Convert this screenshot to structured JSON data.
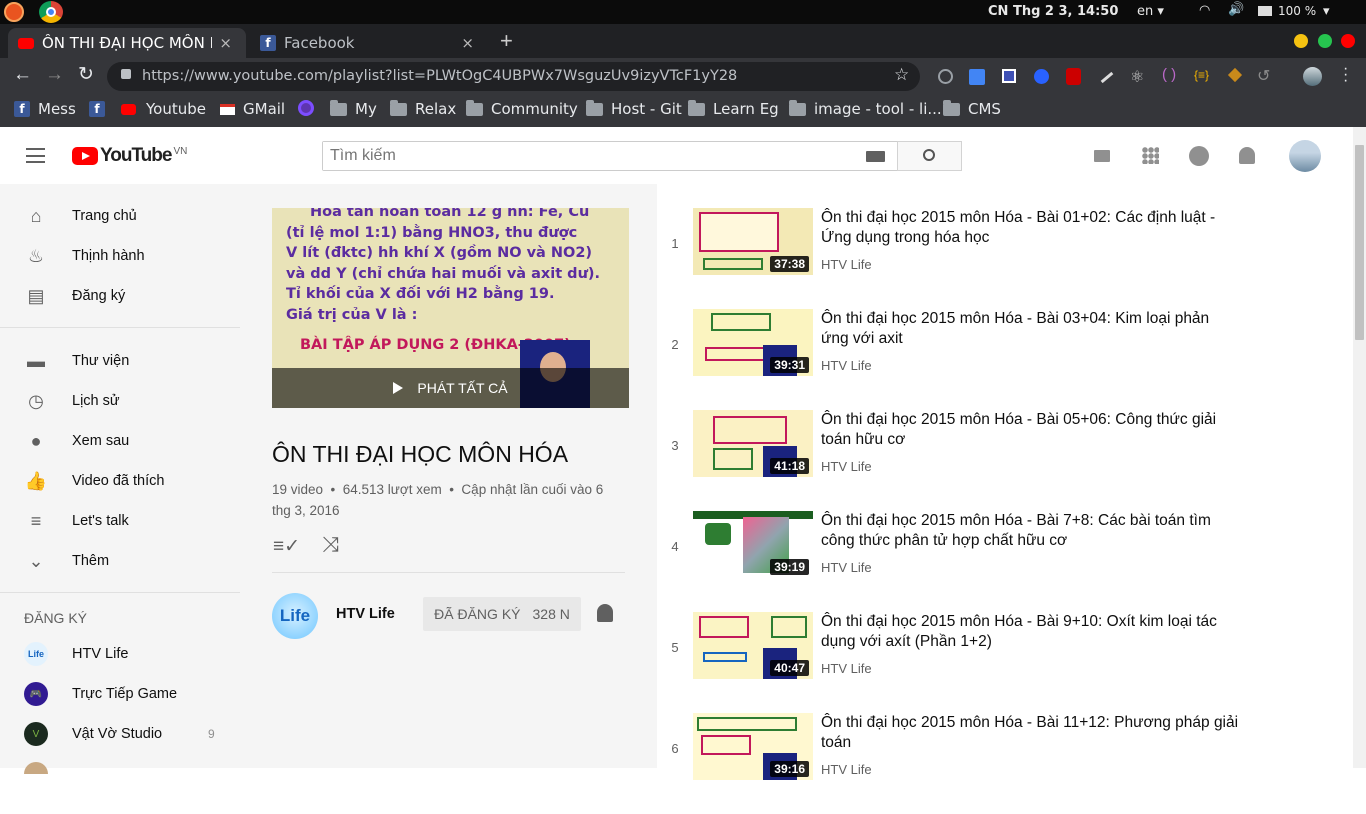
{
  "system_bar": {
    "datetime": "CN Thg 2  3, 14:50",
    "lang": "en",
    "battery": "100 %"
  },
  "tabs": [
    {
      "title": "ÔN THI ĐẠI HỌC MÔN HÓA",
      "icon": "youtube-icon",
      "close": "×"
    },
    {
      "title": "Facebook",
      "icon": "facebook-icon",
      "close": "×"
    }
  ],
  "new_tab": "+",
  "url": "https://www.youtube.com/playlist?list=PLWtOgC4UBPWx7WsguzUv9izyVTcF1yY28",
  "bookmarks": [
    "Mess",
    "Youtube",
    "GMail",
    "My",
    "Relax",
    "Community",
    "Host - Git",
    "Learn Eg",
    "image - tool - li...",
    "CMS"
  ],
  "yt": {
    "logo": "YouTube",
    "region": "VN",
    "search_placeholder": "Tìm kiếm"
  },
  "sidebar": {
    "items": [
      {
        "label": "Trang chủ",
        "icon": "home-icon"
      },
      {
        "label": "Thịnh hành",
        "icon": "trending-icon"
      },
      {
        "label": "Đăng ký",
        "icon": "subscriptions-icon"
      },
      {
        "label": "Thư viện",
        "icon": "library-icon"
      },
      {
        "label": "Lịch sử",
        "icon": "history-icon"
      },
      {
        "label": "Xem sau",
        "icon": "watch-later-icon"
      },
      {
        "label": "Video đã thích",
        "icon": "like-icon"
      },
      {
        "label": "Let's talk",
        "icon": "playlist-icon"
      },
      {
        "label": "Thêm",
        "icon": "chevron-down-icon"
      }
    ],
    "subs_header": "ĐĂNG KÝ",
    "subs": [
      {
        "label": "HTV Life",
        "count": ""
      },
      {
        "label": "Trực Tiếp Game",
        "count": ""
      },
      {
        "label": "Vật Vờ Studio",
        "count": "9"
      }
    ]
  },
  "playlist": {
    "play_all": "PHÁT TẤT CẢ",
    "title": "ÔN THI ĐẠI HỌC MÔN HÓA",
    "stats_line1": "19 video  •  64.513 lượt xem  •  Cập nhật lần cuối vào 6",
    "stats_line2": "thg 3, 2016",
    "channel": "HTV Life",
    "subscribed": "ĐÃ ĐĂNG KÝ",
    "sub_count": "328 N",
    "thumb_text": [
      "Hòa tan hoàn toàn 12 g hh: Fe, Cu",
      "(tỉ lệ mol 1:1) bằng HNO3, thu được",
      "V lít (đktc) hh khí X (gồm NO và NO2)",
      "và dd Y (chỉ chứa hai muối và axit dư).",
      "Tỉ khối của X đối với H2 bằng 19.",
      "Giá trị của V là :",
      "BÀI TẬP ÁP DỤNG 2 (ĐHKA-2007)"
    ]
  },
  "videos": [
    {
      "index": "1",
      "title": "Ôn thi đại học 2015 môn Hóa - Bài 01+02: Các định luật - Ứng dụng trong hóa học",
      "channel": "HTV Life",
      "duration": "37:38"
    },
    {
      "index": "2",
      "title": "Ôn thi đại học 2015 môn Hóa - Bài 03+04: Kim loại phản ứng với axit",
      "channel": "HTV Life",
      "duration": "39:31"
    },
    {
      "index": "3",
      "title": "Ôn thi đại học 2015 môn Hóa - Bài 05+06: Công thức giải toán hữu cơ",
      "channel": "HTV Life",
      "duration": "41:18"
    },
    {
      "index": "4",
      "title": "Ôn thi đại học 2015 môn Hóa - Bài 7+8: Các bài toán tìm công thức phân tử hợp chất hữu cơ",
      "channel": "HTV Life",
      "duration": "39:19"
    },
    {
      "index": "5",
      "title": "Ôn thi đại học 2015 môn Hóa - Bài 9+10: Oxít kim loại tác dụng với axít (Phần 1+2)",
      "channel": "HTV Life",
      "duration": "40:47"
    },
    {
      "index": "6",
      "title": "Ôn thi đại học 2015 môn Hóa - Bài 11+12: Phương pháp giải toán",
      "channel": "HTV Life",
      "duration": "39:16"
    }
  ]
}
